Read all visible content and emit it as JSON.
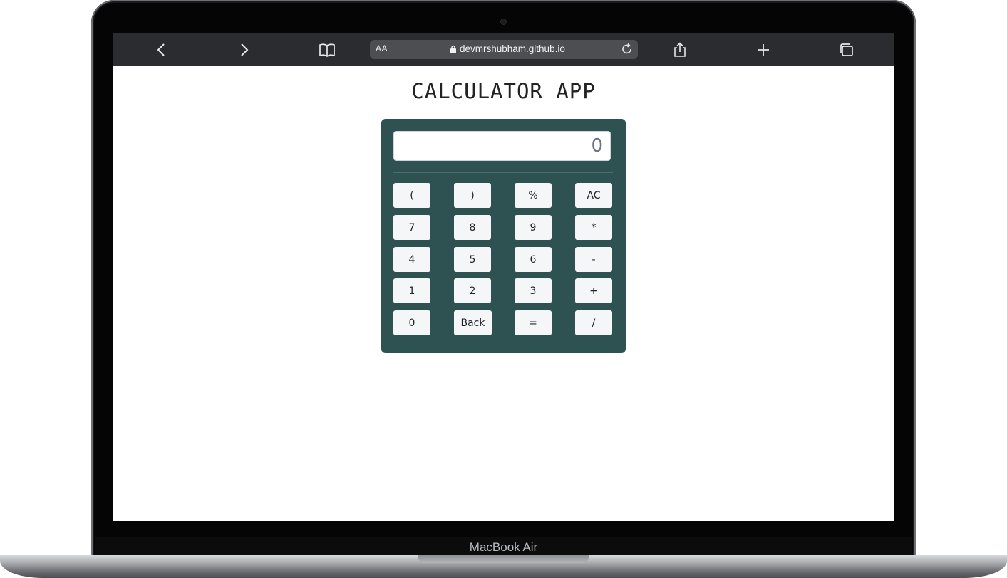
{
  "browser": {
    "text_size_label": "AA",
    "url": "devmrshubham.github.io"
  },
  "page": {
    "title": "CALCULATOR APP"
  },
  "calculator": {
    "display_value": "0",
    "rows": [
      [
        "(",
        ")",
        "%",
        "AC"
      ],
      [
        "7",
        "8",
        "9",
        "*"
      ],
      [
        "4",
        "5",
        "6",
        "-"
      ],
      [
        "1",
        "2",
        "3",
        "+"
      ],
      [
        "0",
        "Back",
        "=",
        "/"
      ]
    ],
    "panel_color": "#2e5251",
    "key_color": "#f5f6f8"
  },
  "device": {
    "model": "MacBook Air"
  }
}
